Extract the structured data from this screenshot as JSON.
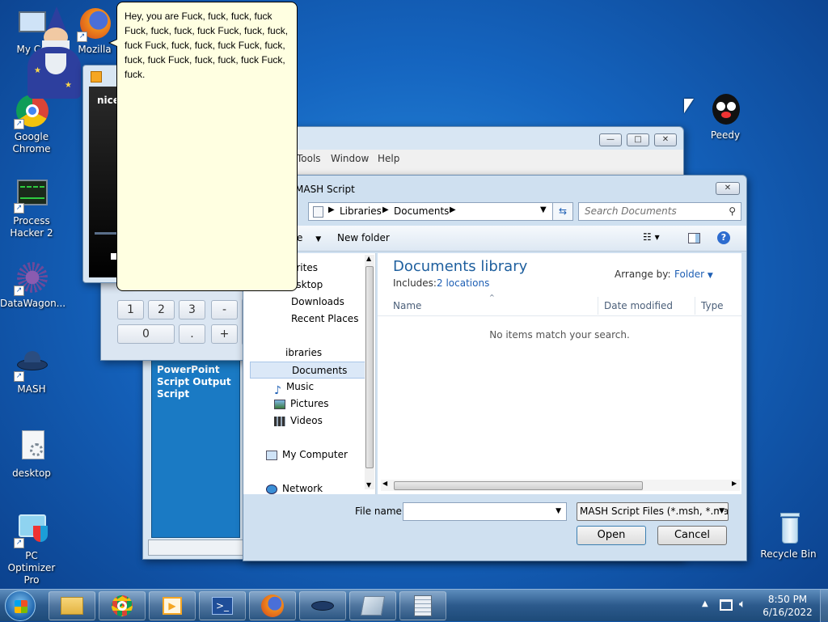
{
  "desktop": {
    "icons": [
      {
        "label": "My Co"
      },
      {
        "label": "Mozilla"
      },
      {
        "label": "Google Chrome"
      },
      {
        "label": "Process Hacker 2"
      },
      {
        "label": "DataWagon..."
      },
      {
        "label": "MASH"
      },
      {
        "label": "desktop"
      },
      {
        "label": "PC Optimizer Pro"
      },
      {
        "label": "Peedy"
      },
      {
        "label": "Recycle Bin"
      }
    ]
  },
  "speech_bubble": {
    "text": "Hey, you are Fuck, fuck, fuck, fuck Fuck, fuck, fuck, fuck Fuck, fuck, fuck, fuck Fuck, fuck, fuck, fuck Fuck, fuck, fuck, fuck Fuck, fuck, fuck, fuck Fuck, fuck."
  },
  "media_window": {
    "caption_text": "nice"
  },
  "calculator": {
    "keys": [
      "1",
      "2",
      "3",
      "-",
      "0",
      ".",
      "+",
      "="
    ]
  },
  "mash_window": {
    "menu": [
      "Tools",
      "Window",
      "Help"
    ],
    "side_panel_text": "PowerPoint Script Output Script"
  },
  "dialog": {
    "title": "MASH Script",
    "breadcrumb": [
      "Libraries",
      "Documents"
    ],
    "search_placeholder": "Search Documents",
    "toolbar": {
      "organize": "e",
      "new_folder": "New folder"
    },
    "nav": {
      "favorites": "orites",
      "desktop": "esktop",
      "downloads": "Downloads",
      "recent": "Recent Places",
      "libraries": "ibraries",
      "documents": "Documents",
      "music": "Music",
      "pictures": "Pictures",
      "videos": "Videos",
      "computer": "My Computer",
      "network": "Network"
    },
    "library_title": "Documents library",
    "includes_label": "Includes:",
    "includes_link": "2 locations",
    "arrange_label": "Arrange by:",
    "arrange_value": "Folder",
    "columns": [
      "Name",
      "Date modified",
      "Type"
    ],
    "empty_message": "No items match your search.",
    "file_name_label": "File name:",
    "file_name_value": "",
    "file_type": "MASH Script Files (*.msh, *.mas",
    "open_label": "Open",
    "cancel_label": "Cancel"
  },
  "tray": {
    "time": "8:50 PM",
    "date": "6/16/2022"
  },
  "colors": {
    "link": "#1e5fb4",
    "library_title": "#1e5f9e",
    "side_panel": "#1a7ac4"
  }
}
